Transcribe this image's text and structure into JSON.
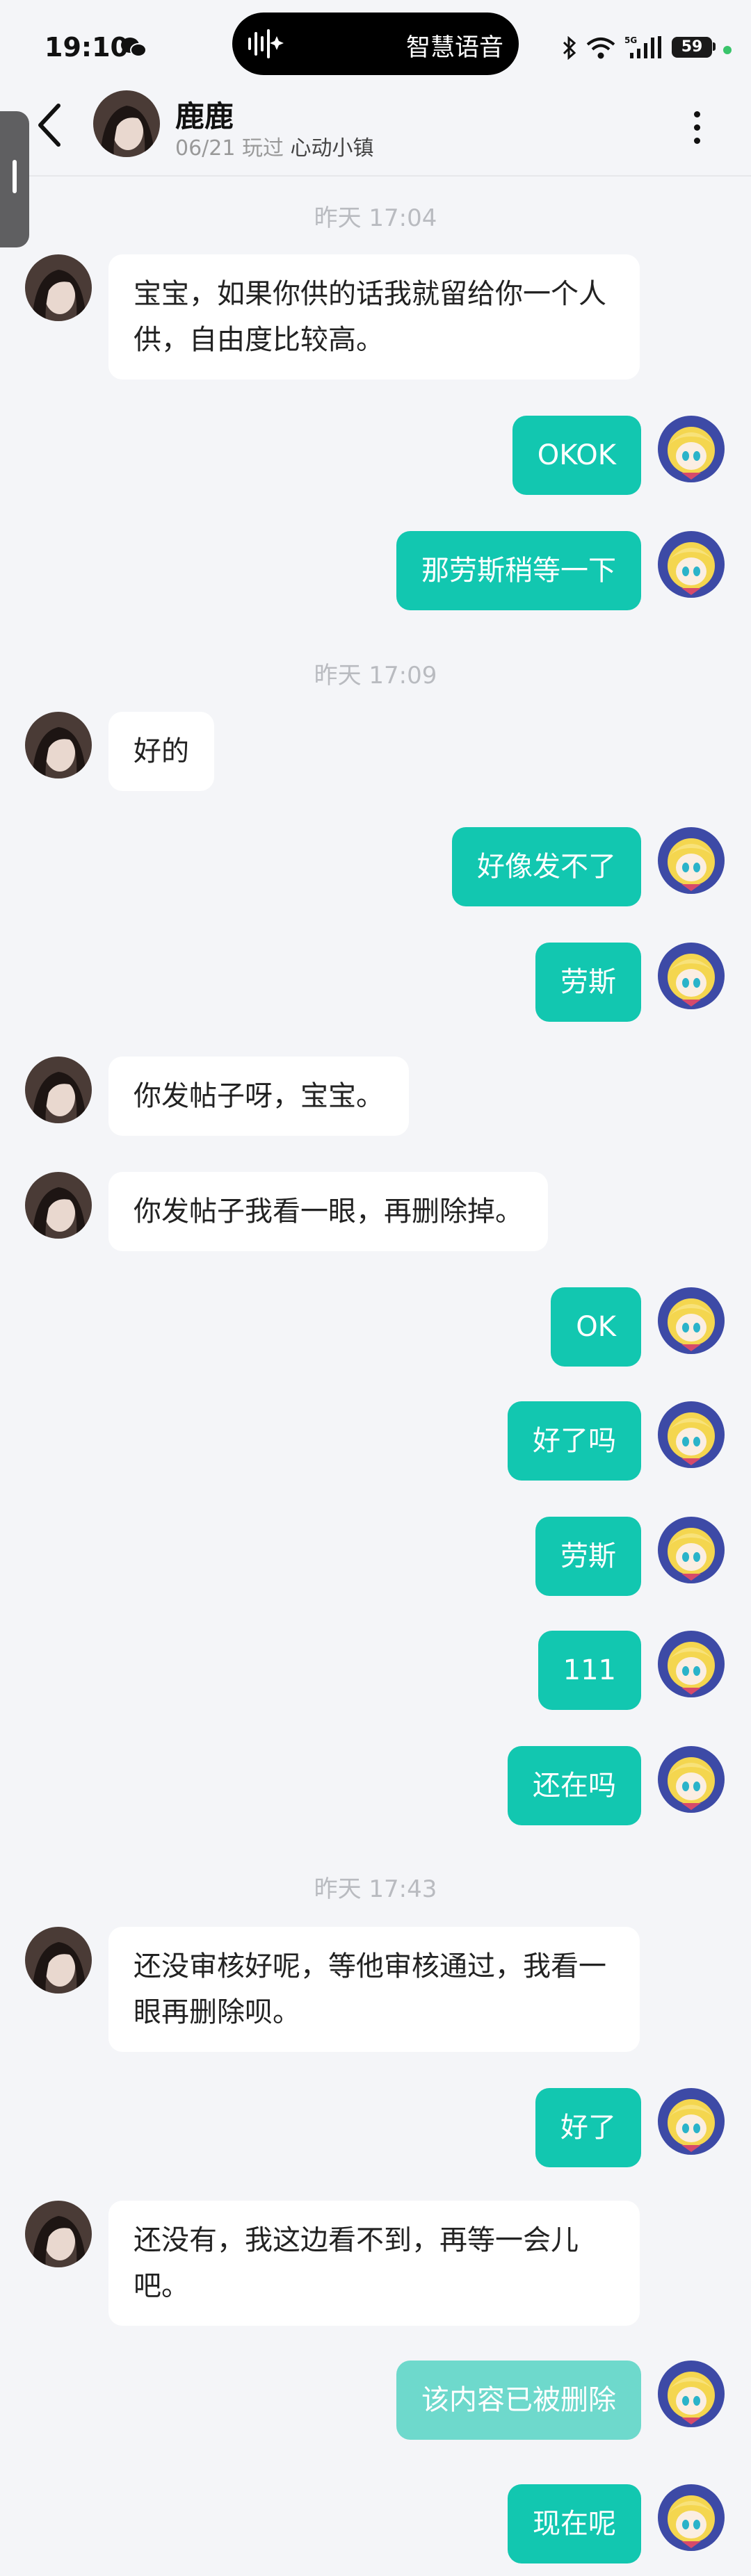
{
  "status_bar": {
    "time": "19:10",
    "island_text": "智慧语音",
    "battery": "59"
  },
  "header": {
    "title": "鹿鹿",
    "subtitle_prefix": "06/21 玩过",
    "subtitle_place": "心动小镇"
  },
  "colors": {
    "accent": "#12c7b0",
    "background": "#f4f5f8",
    "incoming_bubble": "#ffffff"
  },
  "icons": {
    "back": "chevron-left-icon",
    "more": "more-vertical-icon",
    "wechat": "wechat-icon",
    "voice": "voice-wave-icon",
    "signal": "signal-icon",
    "wifi": "wifi-icon",
    "bluetooth": "bluetooth-icon"
  },
  "messages": [
    {
      "type": "time",
      "text": "昨天  17:04"
    },
    {
      "side": "left",
      "text": "宝宝，如果你供的话我就留给你一个人供，自由度比较高。"
    },
    {
      "side": "right",
      "text": "OKOK"
    },
    {
      "side": "right",
      "text": "那劳斯稍等一下"
    },
    {
      "type": "time",
      "text": "昨天  17:09"
    },
    {
      "side": "left",
      "text": "好的"
    },
    {
      "side": "right",
      "text": "好像发不了"
    },
    {
      "side": "right",
      "text": "劳斯"
    },
    {
      "side": "left",
      "text": "你发帖子呀，宝宝。"
    },
    {
      "side": "left",
      "text": "你发帖子我看一眼，再删除掉。"
    },
    {
      "side": "right",
      "text": "OK"
    },
    {
      "side": "right",
      "text": "好了吗"
    },
    {
      "side": "right",
      "text": "劳斯"
    },
    {
      "side": "right",
      "text": "111"
    },
    {
      "side": "right",
      "text": "还在吗"
    },
    {
      "type": "time",
      "text": "昨天  17:43"
    },
    {
      "side": "left",
      "text": "还没审核好呢，等他审核通过，我看一眼再删除呗。"
    },
    {
      "side": "right",
      "text": "好了"
    },
    {
      "side": "left",
      "text": "还没有，我这边看不到，再等一会儿吧。"
    },
    {
      "side": "right",
      "text": "该内容已被删除",
      "status": "deleted"
    },
    {
      "side": "right",
      "text": "现在呢"
    }
  ]
}
